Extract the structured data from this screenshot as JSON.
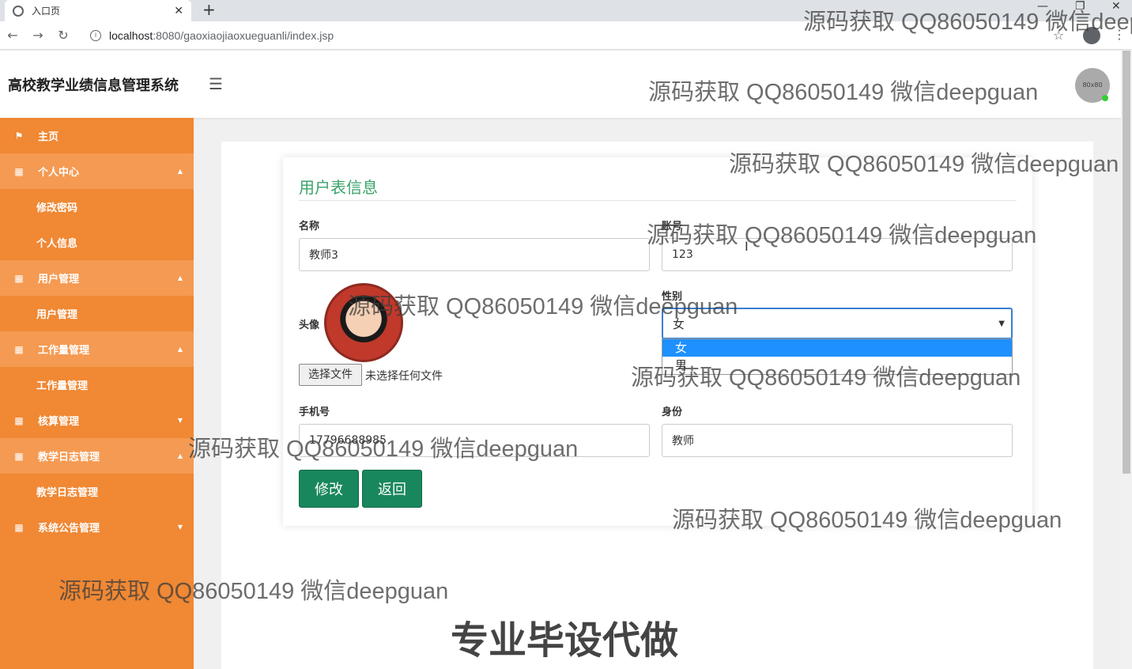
{
  "browser": {
    "tab_title": "入口页",
    "url_host": "localhost",
    "url_path": ":8080/gaoxiaojiaoxueguanli/index.jsp"
  },
  "header": {
    "title": "高校教学业绩信息管理系统",
    "avatar_text": "80x80"
  },
  "sidebar": {
    "items": [
      {
        "label": "主页",
        "type": "item",
        "icon": "flag-icon"
      },
      {
        "label": "个人中心",
        "type": "group",
        "icon": "grid-icon",
        "caret": "up"
      },
      {
        "label": "修改密码",
        "type": "sub"
      },
      {
        "label": "个人信息",
        "type": "sub"
      },
      {
        "label": "用户管理",
        "type": "group",
        "icon": "grid-icon",
        "caret": "up"
      },
      {
        "label": "用户管理",
        "type": "sub"
      },
      {
        "label": "工作量管理",
        "type": "group",
        "icon": "grid-icon",
        "caret": "up"
      },
      {
        "label": "工作量管理",
        "type": "sub"
      },
      {
        "label": "核算管理",
        "type": "group",
        "icon": "grid-icon",
        "caret": "down"
      },
      {
        "label": "教学日志管理",
        "type": "group",
        "icon": "grid-icon",
        "caret": "up"
      },
      {
        "label": "教学日志管理",
        "type": "sub"
      },
      {
        "label": "系统公告管理",
        "type": "group",
        "icon": "grid-icon",
        "caret": "down"
      }
    ]
  },
  "form": {
    "title": "用户表信息",
    "name_label": "名称",
    "name_value": "教师3",
    "account_label": "账号",
    "account_value": "123",
    "avatar_label": "头像",
    "gender_label": "性别",
    "gender_value": "女",
    "gender_options": [
      "女",
      "男"
    ],
    "file_button": "选择文件",
    "file_status": "未选择任何文件",
    "phone_label": "手机号",
    "phone_value": "17796688985",
    "role_label": "身份",
    "role_value": "教师",
    "submit_label": "修改",
    "back_label": "返回"
  },
  "overlay": {
    "watermark": "源码获取 QQ86050149 微信deepguan",
    "banner": "专业毕设代做"
  }
}
